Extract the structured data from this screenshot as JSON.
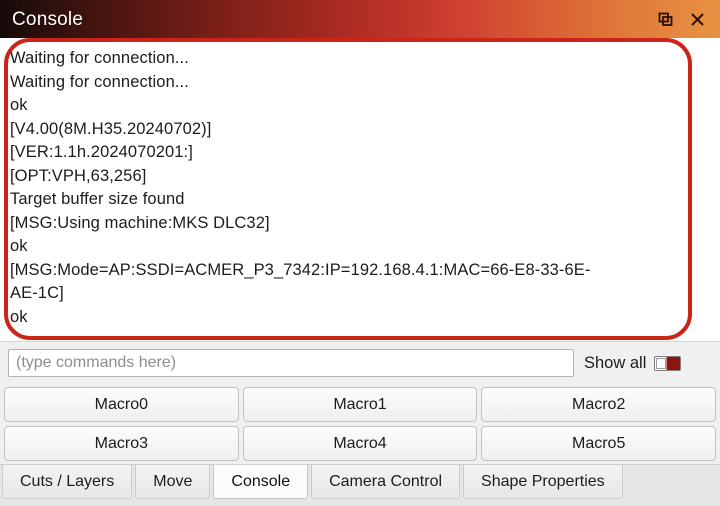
{
  "titlebar": {
    "title": "Console",
    "float_icon": "float-window-icon",
    "close_icon": "close-icon",
    "gradient_start": "#150a08",
    "gradient_end": "#e79243"
  },
  "console": {
    "lines": [
      "Waiting for connection...",
      "Waiting for connection...",
      "ok",
      "[V4.00(8M.H35.20240702)]",
      "[VER:1.1h.2024070201:]",
      "[OPT:VPH,63,256]",
      "Target buffer size found",
      "[MSG:Using machine:MKS DLC32]",
      "ok",
      "[MSG:Mode=AP:SSDI=ACMER_P3_7342:IP=192.168.4.1:MAC=66-E8-33-6E-",
      "AE-1C]",
      "ok"
    ],
    "annotation_color": "#cc2418"
  },
  "command": {
    "placeholder": "(type commands here)",
    "value": "",
    "show_all_label": "Show all",
    "show_all_enabled": "on"
  },
  "macros": {
    "rows": [
      [
        "Macro0",
        "Macro1",
        "Macro2"
      ],
      [
        "Macro3",
        "Macro4",
        "Macro5"
      ]
    ]
  },
  "tabs": [
    {
      "label": "Cuts / Layers",
      "active": false
    },
    {
      "label": "Move",
      "active": false
    },
    {
      "label": "Console",
      "active": true
    },
    {
      "label": "Camera Control",
      "active": false
    },
    {
      "label": "Shape Properties",
      "active": false
    }
  ]
}
